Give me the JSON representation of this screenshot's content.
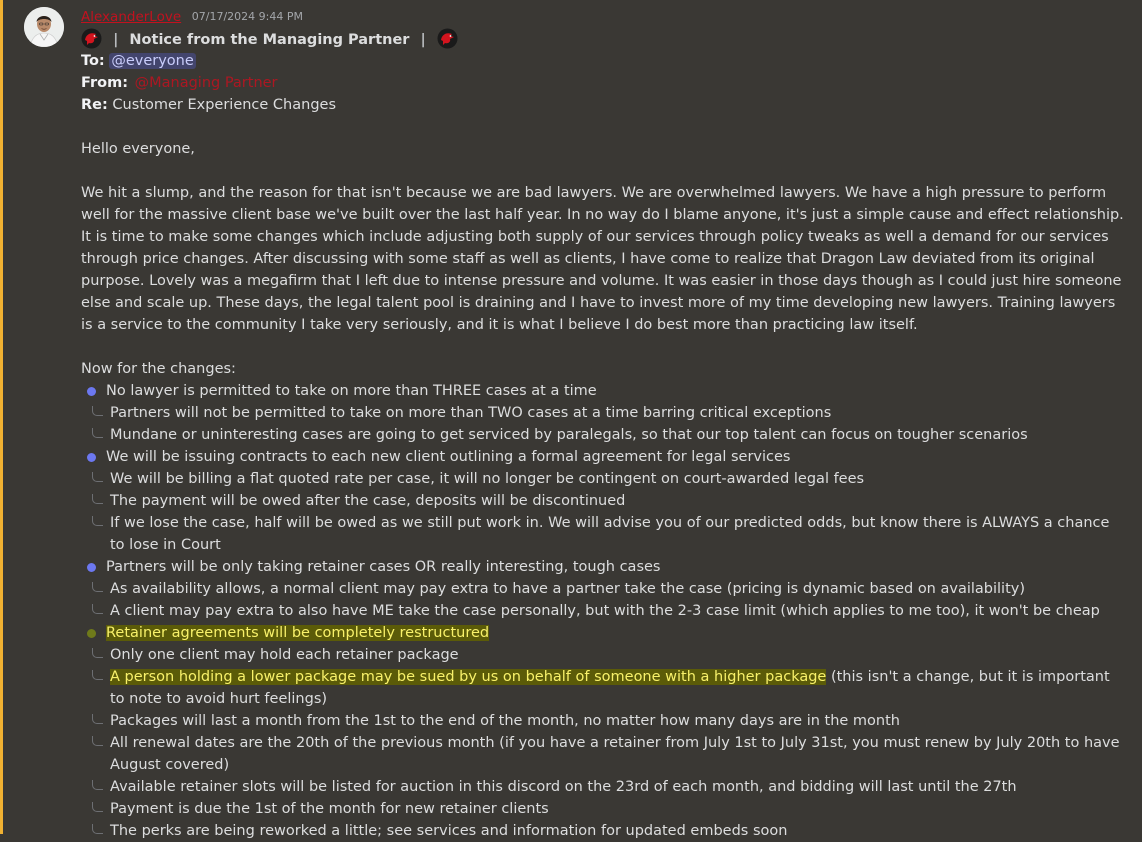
{
  "message": {
    "author": "AlexanderLove",
    "timestamp": "07/17/2024 9:44 PM",
    "title": "Notice from the Managing Partner",
    "title_separator": "|",
    "to_label": "To:",
    "to_value": "@everyone",
    "from_label": "From:",
    "from_value": "@Managing Partner",
    "re_label": "Re:",
    "re_value": "Customer Experience Changes",
    "greeting": "Hello everyone,",
    "body_paragraph": "We hit a slump, and the reason for that isn't because we are bad lawyers. We are overwhelmed lawyers. We have a high pressure to perform well for the massive client base we've built over the last half year. In no way do I blame anyone, it's just a simple cause and effect relationship. It is time to make some changes which include adjusting both supply of our services through policy tweaks as well a demand for our services through price changes. After discussing with some staff as well as clients, I have come to realize that Dragon Law deviated from its original purpose. Lovely was a megafirm that I left due to intense pressure and volume. It was easier in those days though as I could just hire someone else and scale up. These days, the legal talent pool is draining and I have to invest more of my time developing new lawyers. Training lawyers is a service to the community I take very seriously, and it is what I believe I do best more than practicing law itself.",
    "changes_intro": "Now for the changes:",
    "sections": [
      {
        "bullet": "No lawyer is permitted to take on more than THREE cases at a time",
        "subs": [
          "Partners will not be permitted to take on more than TWO cases at a time barring critical exceptions",
          "Mundane or uninteresting cases are going to get serviced by paralegals, so that our top talent can focus on tougher scenarios"
        ]
      },
      {
        "bullet": "We will be issuing contracts to each new client outlining a formal agreement for legal services",
        "subs": [
          "We will be billing a flat quoted rate per case, it will no longer be contingent on court-awarded legal fees",
          "The payment will be owed after the case, deposits will be discontinued",
          "If we lose the case, half will be owed as we still put work in. We will advise you of our predicted odds, but know there is ALWAYS a chance to lose in Court"
        ]
      },
      {
        "bullet": "Partners will be only taking retainer cases OR really interesting, tough cases",
        "subs": [
          "As availability allows, a normal client may pay extra to have a partner take the case (pricing is dynamic based on availability)",
          "A client may pay extra to also have ME take the case personally, but with the 2-3 case limit (which applies to me too), it won't be cheap"
        ]
      },
      {
        "bullet": "Retainer agreements will be completely restructured",
        "sub_only_one": "Only one client may hold each retainer package",
        "sub_lower_hl": "A person holding a lower package may be sued by us on behalf of someone with a higher package",
        "sub_lower_rest": " (this isn't a change, but it is important to note to avoid hurt feelings)",
        "subs_after": [
          "Packages will last a month from the 1st to the end of the month, no matter how many days are in the month",
          "All renewal dates are the 20th of the previous month (if you have a retainer from July 1st to July 31st, you must renew by July 20th to have August covered)",
          "Available retainer slots will be listed for auction in this discord on the 23rd of each month, and bidding will last until the 27th",
          "Payment is due the 1st of the month for new retainer clients",
          "The perks are being reworked a little; see services and information for updated embeds soon"
        ]
      }
    ]
  },
  "colors": {
    "background": "#3a3834",
    "author": "#c1121f",
    "mention_bg": "#4c5196",
    "highlight": "#5b5b08",
    "highlight_text": "#f8f16a",
    "bullet": "#6c78f0",
    "accent_bar": "#f0b132"
  },
  "icons": {
    "avatar": "user-avatar-photo",
    "title_emoji": "red-dragon-icon"
  }
}
